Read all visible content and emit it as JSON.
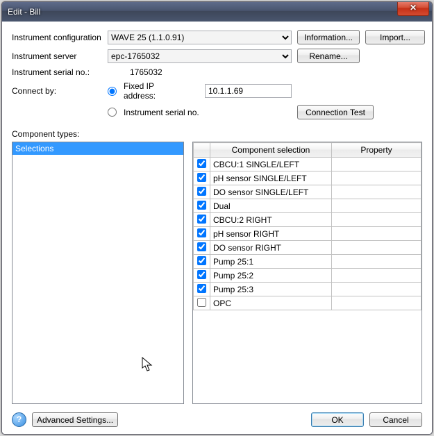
{
  "window": {
    "title": "Edit - Bill"
  },
  "form": {
    "config_label": "Instrument configuration",
    "config_value": "WAVE 25 (1.1.0.91)",
    "info_btn": "Information...",
    "import_btn": "Import...",
    "server_label": "Instrument server",
    "server_value": "epc-1765032",
    "rename_btn": "Rename...",
    "serialno_label": "Instrument serial no.:",
    "serialno_value": "1765032",
    "connectby_label": "Connect by:",
    "radio_fixed": "Fixed IP address:",
    "ip_value": "10.1.1.69",
    "radio_serial": "Instrument serial no.",
    "conn_test_btn": "Connection Test"
  },
  "types": {
    "label": "Component types:",
    "item0": "Selections"
  },
  "table": {
    "col_sel": "Component selection",
    "col_prop": "Property",
    "rows": [
      {
        "checked": true,
        "name": "CBCU:1 SINGLE/LEFT"
      },
      {
        "checked": true,
        "name": "pH sensor SINGLE/LEFT"
      },
      {
        "checked": true,
        "name": "DO sensor SINGLE/LEFT"
      },
      {
        "checked": true,
        "name": "Dual"
      },
      {
        "checked": true,
        "name": "CBCU:2 RIGHT"
      },
      {
        "checked": true,
        "name": "pH sensor RIGHT"
      },
      {
        "checked": true,
        "name": "DO sensor RIGHT"
      },
      {
        "checked": true,
        "name": "Pump 25:1"
      },
      {
        "checked": true,
        "name": "Pump 25:2"
      },
      {
        "checked": true,
        "name": "Pump 25:3"
      },
      {
        "checked": false,
        "name": "OPC"
      }
    ]
  },
  "footer": {
    "advanced": "Advanced Settings...",
    "ok": "OK",
    "cancel": "Cancel"
  }
}
